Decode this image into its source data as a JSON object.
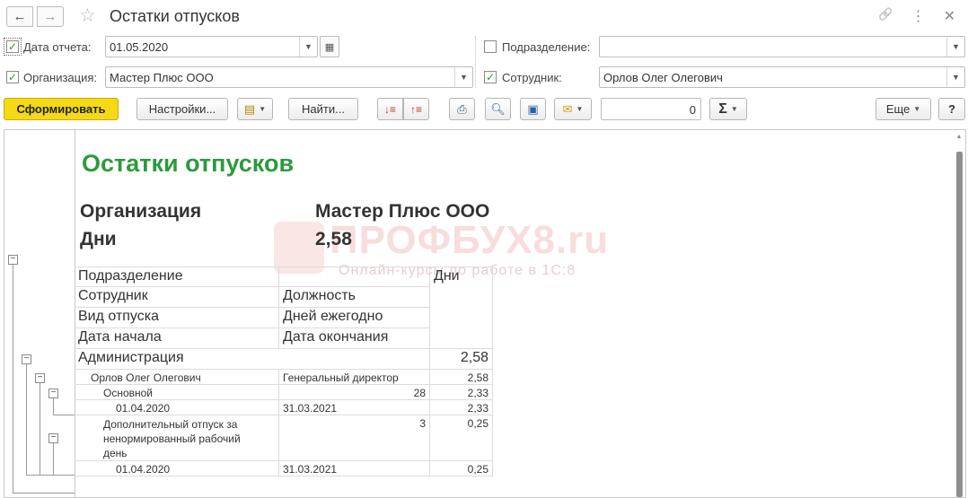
{
  "window": {
    "title": "Остатки отпусков",
    "back_glyph": "←",
    "forward_glyph": "→",
    "star_glyph": "☆",
    "link_glyph": "🔗",
    "more_glyph": "⋮",
    "close_glyph": "✕"
  },
  "filters": {
    "report_date": {
      "label": "Дата отчета:",
      "checked": true,
      "value": "01.05.2020"
    },
    "division": {
      "label": "Подразделение:",
      "checked": false,
      "value": ""
    },
    "organization": {
      "label": "Организация:",
      "checked": true,
      "value": "Мастер Плюс ООО"
    },
    "employee": {
      "label": "Сотрудник:",
      "checked": true,
      "value": "Орлов Олег Олегович"
    }
  },
  "toolbar": {
    "generate": "Сформировать",
    "settings": "Настройки...",
    "find": "Найти...",
    "sum_value": "0",
    "sum_glyph": "Σ",
    "more": "Еще",
    "help": "?"
  },
  "report": {
    "title": "Остатки отпусков",
    "params": [
      {
        "label": "Организация",
        "value": "Мастер Плюс ООО"
      },
      {
        "label": "Дни",
        "value": "2,58"
      }
    ],
    "watermark": {
      "brand": "ПРОФБУХ8.ru",
      "tagline": "Онлайн-курсы по работе в 1С:8"
    },
    "headers": {
      "col1": [
        "Подразделение",
        "Сотрудник",
        "Вид отпуска",
        "Дата начала"
      ],
      "col2": [
        "",
        "Должность",
        "Дней ежегодно",
        "Дата окончания"
      ],
      "col3": "Дни"
    },
    "rows": [
      {
        "c1": "Администрация",
        "c2": "",
        "c3": "2,58"
      },
      {
        "c1": "Орлов Олег Олегович",
        "c2": "Генеральный директор",
        "c3": "2,58"
      },
      {
        "c1": "Основной",
        "c2": "28",
        "c3": "2,33"
      },
      {
        "c1": "01.04.2020",
        "c2": "31.03.2021",
        "c3": "2,33"
      },
      {
        "c1": "Дополнительный отпуск за ненормированный рабочий день",
        "c2": "3",
        "c3": "0,25"
      },
      {
        "c1": "01.04.2020",
        "c2": "31.03.2021",
        "c3": "0,25"
      }
    ]
  }
}
